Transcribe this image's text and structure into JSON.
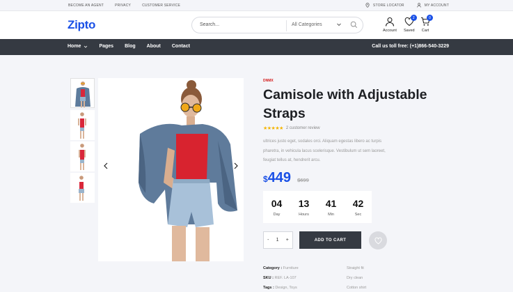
{
  "topbar": {
    "links": [
      "BECOME AN AGENT",
      "PRIVACY",
      "CUSTOMER SERVICE"
    ],
    "store_locator": "STORE LOCATOR",
    "my_account": "MY ACCOUNT"
  },
  "header": {
    "logo": "Zipto",
    "search": {
      "placeholder": "Search...",
      "category": "All Categories"
    },
    "account_label": "Account",
    "saved_label": "Saved",
    "saved_count": "2",
    "cart_label": "Cart",
    "cart_count": "0"
  },
  "nav": {
    "items": [
      "Home",
      "Pages",
      "Blog",
      "About",
      "Contact"
    ],
    "call": "Call us toll free: (+1)866-540-3229"
  },
  "product": {
    "brand": "DNMX",
    "title": "Camisole with Adjustable Straps",
    "rating_stars": 5,
    "reviews": "2 customer review",
    "description": "ultrices justo eget, sodales orci. Aliquam egestas libero ac turpis pharetra, in vehicula lacus scelerisque. Vestibulum ut sem laoreet, feugiat tellus at, hendrerit arcu.",
    "currency": "$",
    "price": "449",
    "old_price": "$699",
    "countdown": [
      {
        "value": "04",
        "unit": "Day"
      },
      {
        "value": "13",
        "unit": "Hours"
      },
      {
        "value": "41",
        "unit": "Min"
      },
      {
        "value": "42",
        "unit": "Sec"
      }
    ],
    "quantity": "1",
    "qty_minus": "-",
    "qty_plus": "+",
    "add_to_cart": "ADD TO CART",
    "category_label": "Category :",
    "category_value": "Furniture",
    "sku_label": "SKU :",
    "sku_value": "REF. LA-107",
    "tags_label": "Tags :",
    "tags_value": "Design, Toys",
    "features": [
      "Straight fit",
      "Dry clean",
      "Cotton shirt"
    ]
  },
  "colors": {
    "accent": "#1a50e6",
    "nav_bg": "#353a42",
    "brand_red": "#d41a1a"
  }
}
